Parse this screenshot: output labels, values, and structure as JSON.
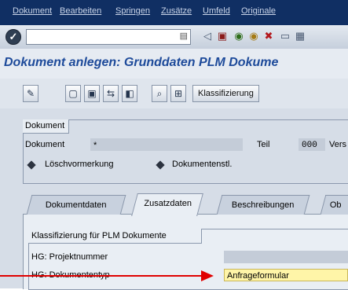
{
  "menu": {
    "items": [
      "Dokument",
      "Bearbeiten",
      "Springen",
      "Zusätze",
      "Umfeld",
      "Originale"
    ]
  },
  "system_toolbar": {
    "command_field_value": ""
  },
  "title": "Dokument anlegen: Grunddaten  PLM Dokume",
  "app_toolbar": {
    "klassifizierung_label": "Klassifizierung"
  },
  "dokument_group": {
    "title": "Dokument",
    "dokument_label": "Dokument",
    "dokument_value": "*",
    "teil_label": "Teil",
    "teil_value": "000",
    "version_label": "Vers",
    "loeschvormerkung_label": "Löschvormerkung",
    "dokumentenstl_label": "Dokumentenstl."
  },
  "tabs": [
    {
      "label": "Dokumentdaten",
      "active": false
    },
    {
      "label": "Zusatzdaten",
      "active": true
    },
    {
      "label": "Beschreibungen",
      "active": false
    },
    {
      "label": "Ob",
      "active": false
    }
  ],
  "klassifizierung_group": {
    "title": "Klassifizierung für PLM Dokumente",
    "projektnummer_label": "HG: Projektnummer",
    "projektnummer_value": "",
    "dokumententyp_label": "HG: Dokumententyp",
    "dokumententyp_value": "Anfrageformular"
  },
  "colors": {
    "menubar": "#102f63",
    "title_text": "#1d4a9a",
    "annotation_arrow": "#e00000"
  }
}
